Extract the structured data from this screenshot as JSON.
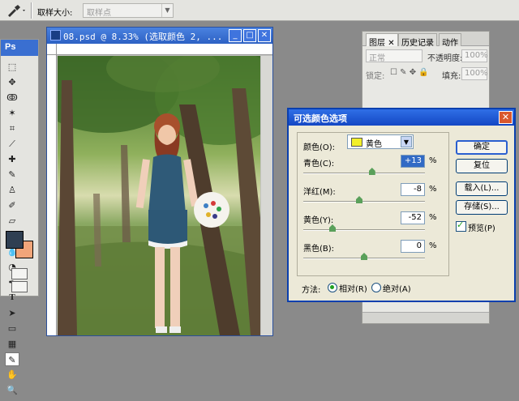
{
  "options_bar": {
    "tool_icon": "eyedropper-icon",
    "sample_size_label": "取样大小:",
    "sample_size_value": "取样点"
  },
  "toolbox": {
    "logo": "Ps",
    "fg_color": "#2f3f52",
    "bg_color": "#f1a57a"
  },
  "document": {
    "title": "08.psd @ 8.33% (选取颜色 2, ..."
  },
  "layers_panel": {
    "tabs": [
      "图层",
      "历史记录",
      "动作"
    ],
    "blend_mode": "正常",
    "opacity_label": "不透明度:",
    "opacity_value": "100%",
    "lock_label": "锁定:",
    "fill_label": "填充:",
    "fill_value": "100%"
  },
  "dialog": {
    "title": "可选颜色选项",
    "color_label": "颜色(O):",
    "color_value": "黄色",
    "color_swatch": "#f2ef2a",
    "sliders": [
      {
        "label": "青色(C):",
        "value": "+13",
        "percent": "%",
        "level": 13
      },
      {
        "label": "洋红(M):",
        "value": "-8",
        "percent": "%",
        "level": -8
      },
      {
        "label": "黄色(Y):",
        "value": "-52",
        "percent": "%",
        "level": -52
      },
      {
        "label": "黑色(B):",
        "value": "0",
        "percent": "%",
        "level": 0
      }
    ],
    "method_label": "方法:",
    "method_relative": "相对(R)",
    "method_absolute": "绝对(A)",
    "buttons": {
      "ok": "确定",
      "reset": "复位",
      "load": "载入(L)...",
      "save": "存储(S)..."
    },
    "preview_label": "预览(P)"
  }
}
